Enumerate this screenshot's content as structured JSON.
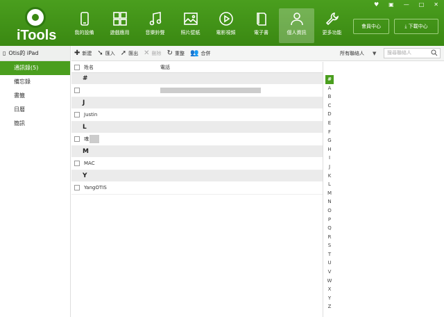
{
  "app": {
    "name": "iTools"
  },
  "nav": [
    {
      "label": "我的設備",
      "icon": "phone-icon",
      "active": false
    },
    {
      "label": "遊戲應用",
      "icon": "apps-icon",
      "active": false
    },
    {
      "label": "音樂鈴聲",
      "icon": "music-icon",
      "active": false
    },
    {
      "label": "照片壁紙",
      "icon": "photo-icon",
      "active": false
    },
    {
      "label": "電影視頻",
      "icon": "play-icon",
      "active": false
    },
    {
      "label": "電子書",
      "icon": "book-icon",
      "active": false
    },
    {
      "label": "個人資訊",
      "icon": "person-icon",
      "active": true
    },
    {
      "label": "更多功能",
      "icon": "wrench-icon",
      "active": false
    }
  ],
  "header": {
    "member_label": "會員中心",
    "download_label": "下載中心"
  },
  "sidebar": {
    "device": "Otis的 iPad",
    "items": [
      {
        "label": "通訊錄(5)",
        "active": true
      },
      {
        "label": "備忘錄",
        "active": false
      },
      {
        "label": "書籤",
        "active": false
      },
      {
        "label": "日曆",
        "active": false
      },
      {
        "label": "簡訊",
        "active": false
      }
    ]
  },
  "toolbar": {
    "new": "新建",
    "import": "匯入",
    "export": "匯出",
    "delete": "刪除",
    "refresh": "重整",
    "merge": "合併",
    "filter": "所有聯絡人",
    "search_placeholder": "搜尋聯絡人"
  },
  "list": {
    "col_name": "姓名",
    "col_phone": "電話",
    "groups": [
      {
        "letter": "#",
        "rows": [
          {
            "name": ""
          }
        ]
      },
      {
        "letter": "J",
        "rows": [
          {
            "name": "Justin"
          }
        ]
      },
      {
        "letter": "L",
        "rows": [
          {
            "name": "魂"
          }
        ]
      },
      {
        "letter": "M",
        "rows": [
          {
            "name": "MAC"
          }
        ]
      },
      {
        "letter": "Y",
        "rows": [
          {
            "name": "YangOTIS"
          }
        ]
      }
    ]
  },
  "alphabet": [
    "#",
    "A",
    "B",
    "C",
    "D",
    "E",
    "F",
    "G",
    "H",
    "I",
    "J",
    "K",
    "L",
    "M",
    "N",
    "O",
    "P",
    "Q",
    "R",
    "S",
    "T",
    "U",
    "V",
    "W",
    "X",
    "Y",
    "Z"
  ],
  "colors": {
    "accent": "#4a9e1e"
  }
}
